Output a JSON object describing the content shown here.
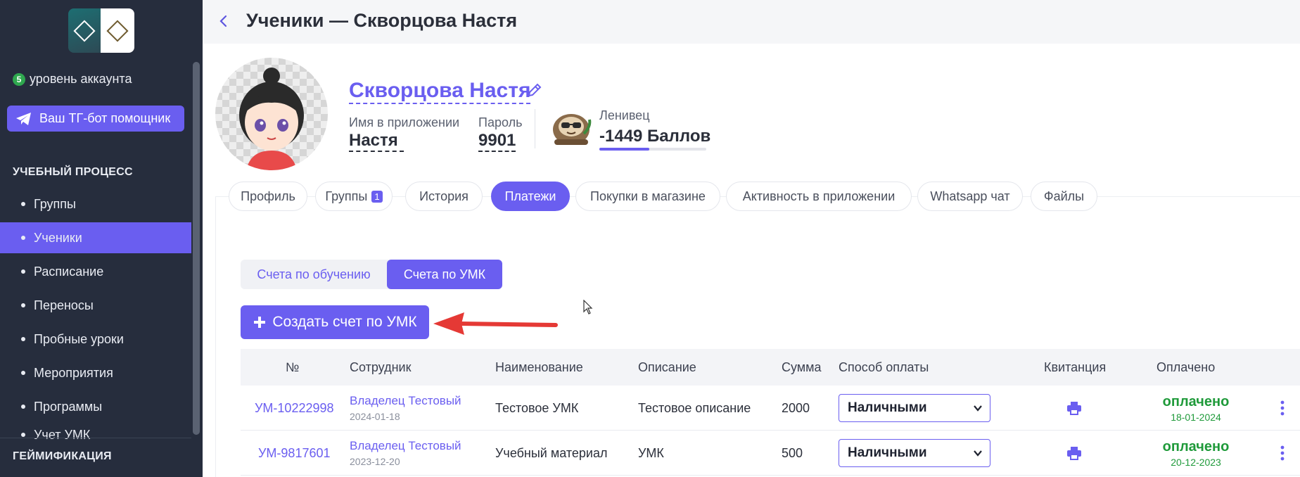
{
  "header": {
    "title": "Ученики — Скворцова Настя"
  },
  "sidebar": {
    "account_level_number": "5",
    "account_level_label": "уровень аккаунта",
    "tg_button_label": "Ваш ТГ-бот помощник",
    "section_learning": "УЧЕБНЫЙ ПРОЦЕСС",
    "items": [
      {
        "label": "Группы",
        "active": false
      },
      {
        "label": "Ученики",
        "active": true
      },
      {
        "label": "Расписание",
        "active": false
      },
      {
        "label": "Переносы",
        "active": false
      },
      {
        "label": "Пробные уроки",
        "active": false
      },
      {
        "label": "Мероприятия",
        "active": false
      },
      {
        "label": "Программы",
        "active": false
      },
      {
        "label": "Учет УМК",
        "active": false
      }
    ],
    "section_gamification": "ГЕЙМИФИКАЦИЯ"
  },
  "profile": {
    "name": "Скворцова Настя",
    "app_name_label": "Имя в приложении",
    "app_name_value": "Настя",
    "password_label": "Пароль",
    "password_value": "9901",
    "rank_label": "Ленивец",
    "points": "-1449 Баллов",
    "points_progress": 0.47
  },
  "tabs": [
    {
      "label": "Профиль"
    },
    {
      "label": "Группы",
      "count": "1"
    },
    {
      "label": "История"
    },
    {
      "label": "Платежи",
      "active": true
    },
    {
      "label": "Покупки в магазине"
    },
    {
      "label": "Активность в приложении"
    },
    {
      "label": "Whatsapp чат"
    },
    {
      "label": "Файлы"
    }
  ],
  "subtabs": {
    "tuition": "Счета по обучению",
    "umk": "Счета по УМК"
  },
  "create_button_label": "Создать счет по УМК",
  "table": {
    "headers": [
      "№",
      "Сотрудник",
      "Наименование",
      "Описание",
      "Сумма",
      "Способ оплаты",
      "Квитанция",
      "Оплачено"
    ],
    "rows": [
      {
        "number": "УМ-10222998",
        "employee": "Владелец Тестовый",
        "date": "2024-01-18",
        "name": "Тестовое УМК",
        "description": "Тестовое описание",
        "sum": "2000",
        "payment": "Наличными",
        "status": "оплачено",
        "paid_date": "18-01-2024"
      },
      {
        "number": "УМ-9817601",
        "employee": "Владелец Тестовый",
        "date": "2023-12-20",
        "name": "Учебный материал",
        "description": "УМК",
        "sum": "500",
        "payment": "Наличными",
        "status": "оплачено",
        "paid_date": "20-12-2023"
      }
    ]
  },
  "colors": {
    "accent": "#6a5ef0",
    "sidebar": "#262d3d",
    "paid": "#1f9a3a",
    "arrow": "#e53935"
  }
}
